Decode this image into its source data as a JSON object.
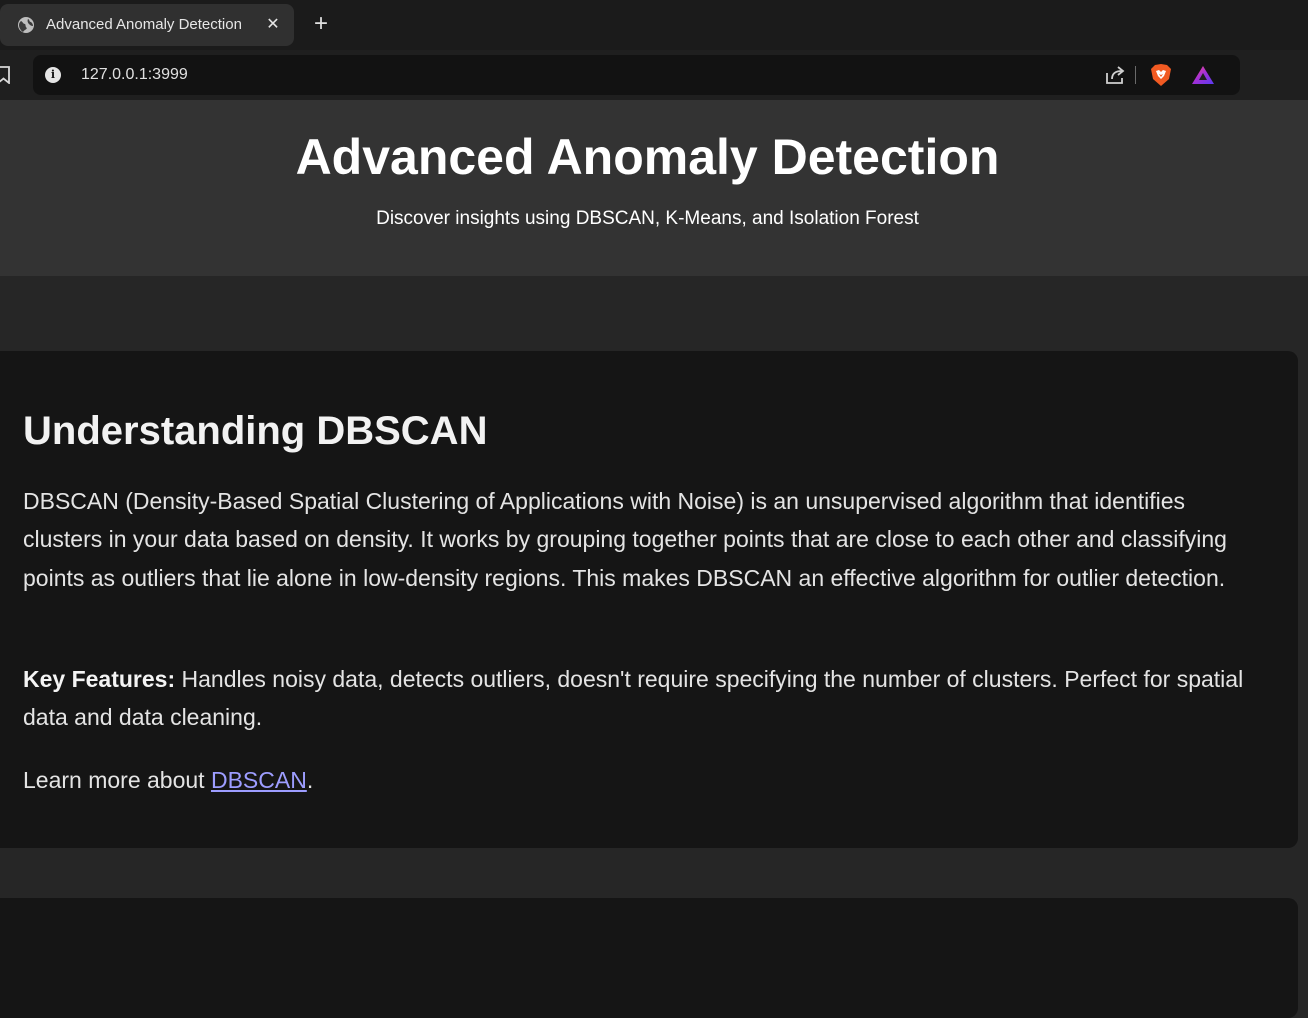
{
  "browser": {
    "tab": {
      "title": "Advanced Anomaly Detection",
      "close": "✕",
      "icon": "globe-icon"
    },
    "new_tab": "+",
    "address": {
      "url": "127.0.0.1:3999",
      "info_glyph": "i"
    },
    "toolbar_icons": [
      "bookmark-icon",
      "info-icon",
      "share-icon",
      "brave-shield-icon",
      "brave-rewards-icon"
    ]
  },
  "header": {
    "title": "Advanced Anomaly Detection",
    "subtitle": "Discover insights using DBSCAN, K-Means, and Isolation Forest"
  },
  "sections": [
    {
      "heading": "Understanding DBSCAN",
      "intro": "DBSCAN (Density-Based Spatial Clustering of Applications with Noise) is an unsupervised algorithm that identifies clusters in your data based on density. It works by grouping together points that are close to each other and classifying points as outliers that lie alone in low-density regions. This makes DBSCAN an effective algorithm for outlier detection.",
      "key_features_label": "Key Features:",
      "key_features_text": " Handles noisy data, detects outliers, doesn't require specifying the number of clusters. Perfect for spatial data and data cleaning.",
      "learn_more_prefix": "Learn more about ",
      "learn_more_link": "DBSCAN",
      "learn_more_suffix": "."
    }
  ],
  "colors": {
    "page_bg": "#262626",
    "hero_bg": "#333333",
    "card_bg": "#151515",
    "link": "#9d9dff"
  }
}
